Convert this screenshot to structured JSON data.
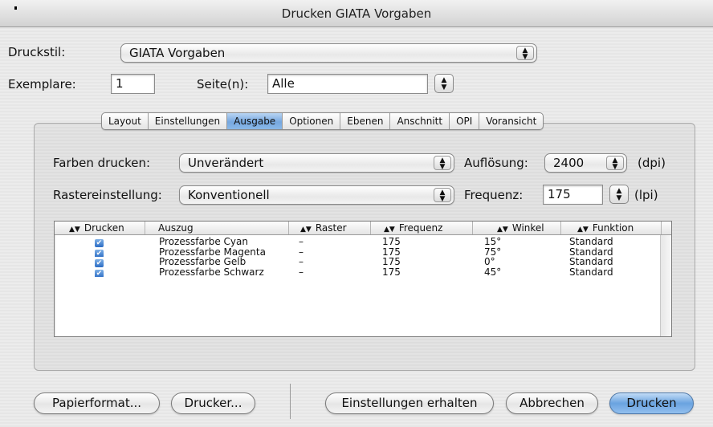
{
  "window": {
    "title": "Drucken GIATA Vorgaben"
  },
  "druckstil": {
    "label": "Druckstil:",
    "value": "GIATA Vorgaben"
  },
  "exemplare": {
    "label": "Exemplare:",
    "value": "1"
  },
  "seiten": {
    "label": "Seite(n):",
    "value": "Alle"
  },
  "tabs": [
    {
      "label": "Layout",
      "selected": false
    },
    {
      "label": "Einstellungen",
      "selected": false
    },
    {
      "label": "Ausgabe",
      "selected": true
    },
    {
      "label": "Optionen",
      "selected": false
    },
    {
      "label": "Ebenen",
      "selected": false
    },
    {
      "label": "Anschnitt",
      "selected": false
    },
    {
      "label": "OPI",
      "selected": false
    },
    {
      "label": "Voransicht",
      "selected": false
    }
  ],
  "ausgabe": {
    "farben_label": "Farben drucken:",
    "farben_value": "Unverändert",
    "raster_label": "Rastereinstellung:",
    "raster_value": "Konventionell",
    "aufloesung_label": "Auflösung:",
    "aufloesung_value": "2400",
    "aufloesung_unit": "(dpi)",
    "frequenz_label": "Frequenz:",
    "frequenz_value": "175",
    "frequenz_unit": "(lpi)"
  },
  "table": {
    "columns": [
      "Drucken",
      "Auszug",
      "Raster",
      "Frequenz",
      "Winkel",
      "Funktion"
    ],
    "rows": [
      {
        "drucken": "✔",
        "auszug": "Prozessfarbe Cyan",
        "raster": "–",
        "frequenz": "175",
        "winkel": "15°",
        "funktion": "Standard"
      },
      {
        "drucken": "✔",
        "auszug": "Prozessfarbe Magenta",
        "raster": "–",
        "frequenz": "175",
        "winkel": "75°",
        "funktion": "Standard"
      },
      {
        "drucken": "✔",
        "auszug": "Prozessfarbe Gelb",
        "raster": "–",
        "frequenz": "175",
        "winkel": "0°",
        "funktion": "Standard"
      },
      {
        "drucken": "✔",
        "auszug": "Prozessfarbe Schwarz",
        "raster": "–",
        "frequenz": "175",
        "winkel": "45°",
        "funktion": "Standard"
      }
    ]
  },
  "buttons": {
    "papierformat": "Papierformat...",
    "drucker": "Drucker...",
    "einstellungen_erhalten": "Einstellungen erhalten",
    "abbrechen": "Abbrechen",
    "drucken": "Drucken"
  },
  "icons": {
    "popup_arrows": "⬍",
    "sort": "⬍"
  },
  "colors": {
    "accent": "#6aa3e0",
    "selected_tab": "#76a8df"
  }
}
